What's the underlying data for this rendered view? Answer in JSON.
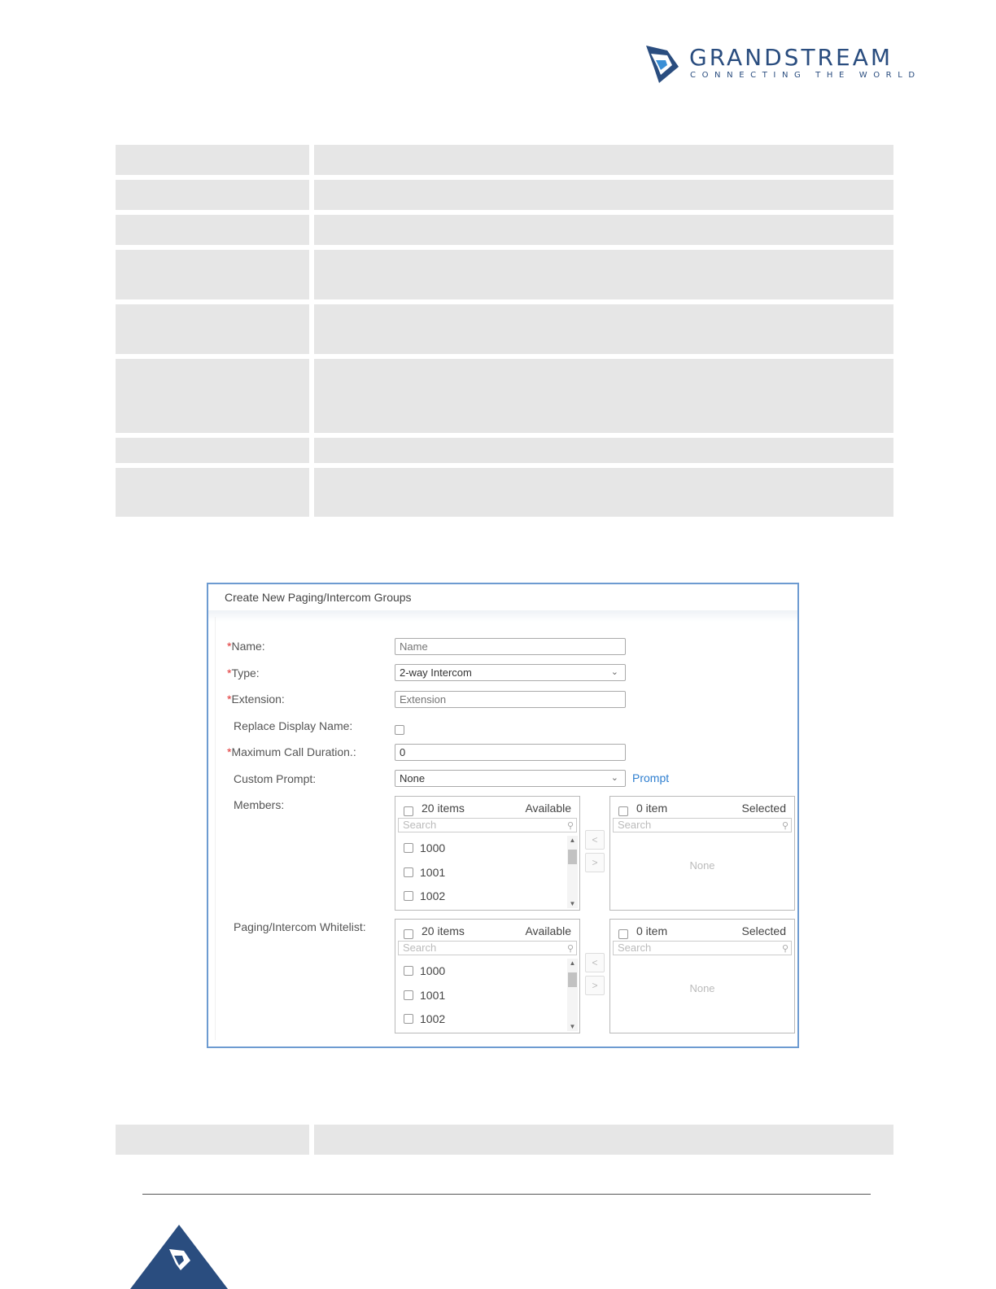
{
  "brand": {
    "name": "GRANDSTREAM",
    "tagline": "CONNECTING THE WORLD",
    "colors": {
      "primary": "#2a4d7f",
      "accent": "#2f7fd0",
      "required": "#e03131"
    }
  },
  "dialog": {
    "title": "Create New Paging/Intercom Groups",
    "fields": {
      "name": {
        "required_mark": "*",
        "label": "Name:",
        "placeholder": "Name"
      },
      "type": {
        "required_mark": "*",
        "label": "Type:",
        "value": "2-way Intercom"
      },
      "extension": {
        "required_mark": "*",
        "label": "Extension:",
        "placeholder": "Extension"
      },
      "replace_display_name": {
        "label": "Replace Display Name:",
        "checked": false
      },
      "max_call_duration": {
        "required_mark": "*",
        "label": "Maximum Call Duration.:",
        "value": "0"
      },
      "custom_prompt": {
        "label": "Custom Prompt:",
        "value": "None",
        "link": "Prompt"
      }
    },
    "members": {
      "label": "Members:",
      "available": {
        "count": "20 items",
        "title": "Available",
        "search_placeholder": "Search",
        "items": [
          "1000",
          "1001",
          "1002"
        ]
      },
      "selected": {
        "count": "0 item",
        "title": "Selected",
        "search_placeholder": "Search",
        "empty": "None"
      },
      "move_left": "<",
      "move_right": ">"
    },
    "whitelist": {
      "label": "Paging/Intercom Whitelist:",
      "available": {
        "count": "20 items",
        "title": "Available",
        "search_placeholder": "Search",
        "items": [
          "1000",
          "1001",
          "1002"
        ]
      },
      "selected": {
        "count": "0 item",
        "title": "Selected",
        "search_placeholder": "Search",
        "empty": "None"
      },
      "move_left": "<",
      "move_right": ">"
    }
  },
  "icons": [
    "grandstream-logo-icon",
    "chevron-down-icon",
    "search-icon",
    "scroll-up-icon",
    "scroll-down-icon",
    "grandstream-corner-icon"
  ]
}
